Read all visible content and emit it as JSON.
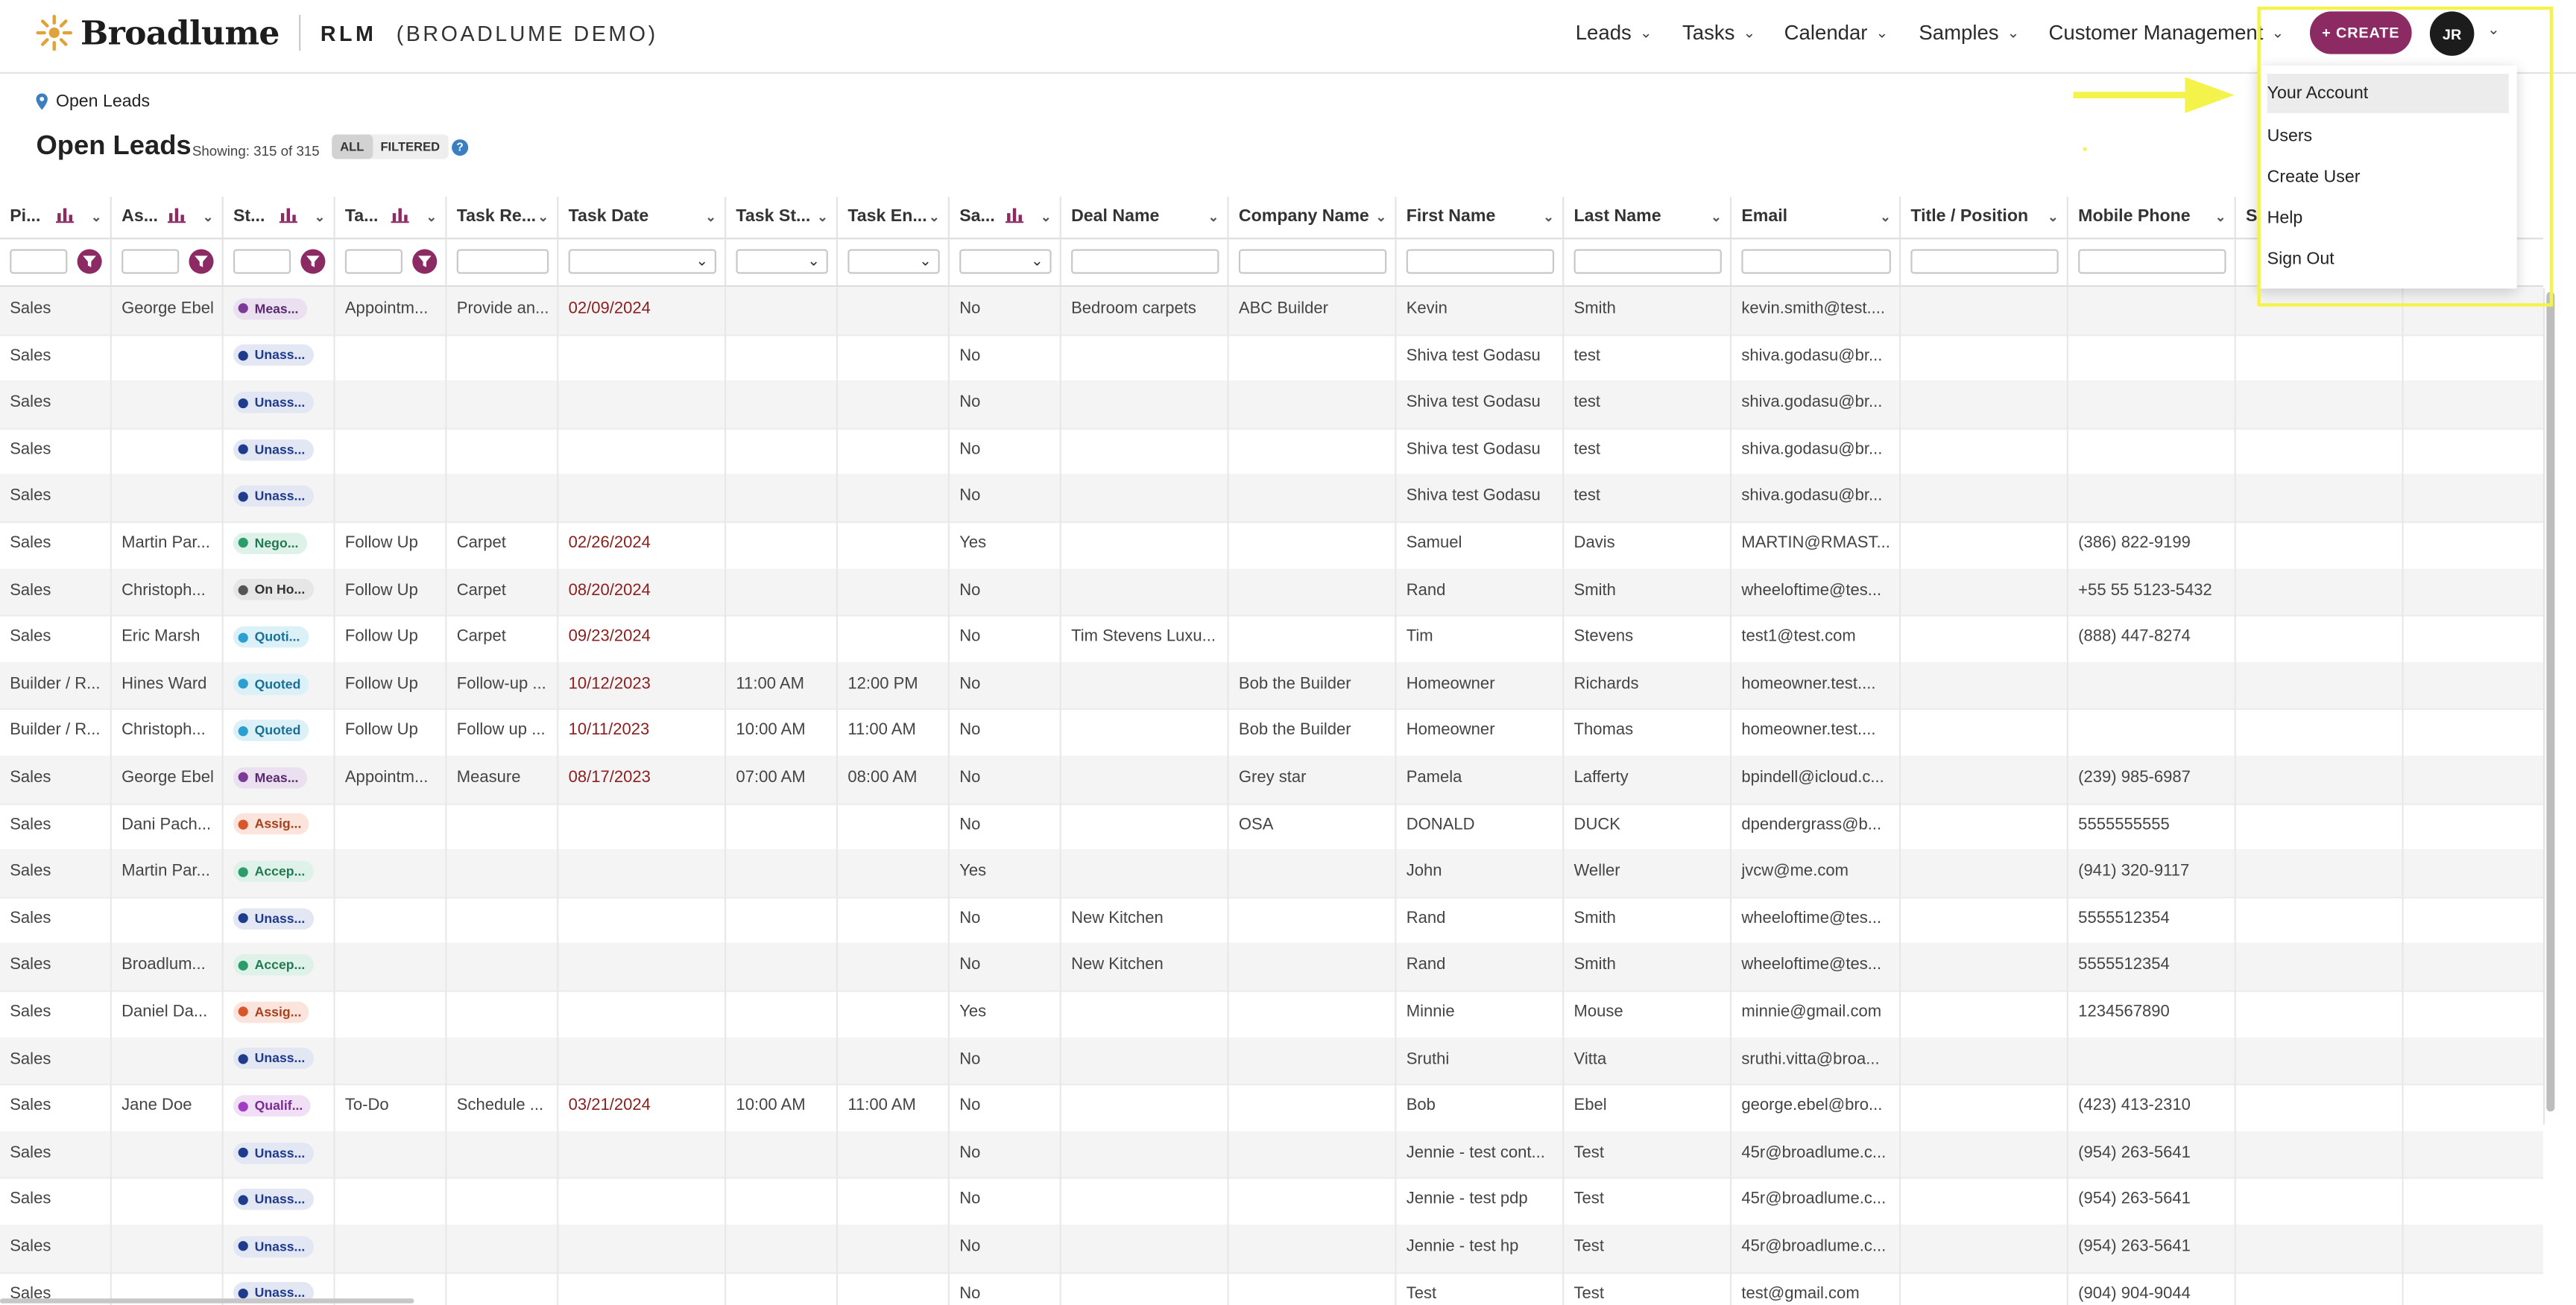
{
  "header": {
    "brand": "Broadlume",
    "app": "RLM",
    "demo": "(BROADLUME DEMO)",
    "nav": [
      {
        "label": "Leads"
      },
      {
        "label": "Tasks"
      },
      {
        "label": "Calendar"
      },
      {
        "label": "Samples"
      },
      {
        "label": "Customer Management"
      }
    ],
    "create_label": "+ CREATE",
    "avatar_initials": "JR",
    "accent_color": "#8c2b63"
  },
  "breadcrumb": {
    "label": "Open Leads",
    "icon": "location-pin-icon"
  },
  "page": {
    "title": "Open Leads",
    "showing": "Showing: 315 of 315",
    "toggle_all": "ALL",
    "toggle_filtered": "FILTERED",
    "help": "?"
  },
  "columns": [
    "Pi...",
    "As...",
    "St...",
    "Ta...",
    "Task Re...",
    "Task Date",
    "Task St...",
    "Task En...",
    "Sa...",
    "Deal Name",
    "Company Name",
    "First Name",
    "Last Name",
    "Email",
    "Title / Position",
    "Mobile Phone",
    "S"
  ],
  "rows": [
    {
      "pipeline": "Sales",
      "assignee": "George Ebel",
      "status": "Meas...",
      "status_kind": "measure",
      "task_type": "Appointm...",
      "task_re": "Provide an...",
      "task_date": "02/09/2024",
      "task_start": "",
      "task_end": "",
      "sample": "No",
      "deal": "Bedroom carpets",
      "company": "ABC Builder",
      "first": "Kevin",
      "last": "Smith",
      "email": "kevin.smith@test....",
      "title": "",
      "mobile": ""
    },
    {
      "pipeline": "Sales",
      "assignee": "",
      "status": "Unass...",
      "status_kind": "unassigned",
      "task_type": "",
      "task_re": "",
      "task_date": "",
      "task_start": "",
      "task_end": "",
      "sample": "No",
      "deal": "",
      "company": "",
      "first": "Shiva test Godasu",
      "last": "test",
      "email": "shiva.godasu@br...",
      "title": "",
      "mobile": ""
    },
    {
      "pipeline": "Sales",
      "assignee": "",
      "status": "Unass...",
      "status_kind": "unassigned",
      "task_type": "",
      "task_re": "",
      "task_date": "",
      "task_start": "",
      "task_end": "",
      "sample": "No",
      "deal": "",
      "company": "",
      "first": "Shiva test Godasu",
      "last": "test",
      "email": "shiva.godasu@br...",
      "title": "",
      "mobile": ""
    },
    {
      "pipeline": "Sales",
      "assignee": "",
      "status": "Unass...",
      "status_kind": "unassigned",
      "task_type": "",
      "task_re": "",
      "task_date": "",
      "task_start": "",
      "task_end": "",
      "sample": "No",
      "deal": "",
      "company": "",
      "first": "Shiva test Godasu",
      "last": "test",
      "email": "shiva.godasu@br...",
      "title": "",
      "mobile": ""
    },
    {
      "pipeline": "Sales",
      "assignee": "",
      "status": "Unass...",
      "status_kind": "unassigned",
      "task_type": "",
      "task_re": "",
      "task_date": "",
      "task_start": "",
      "task_end": "",
      "sample": "No",
      "deal": "",
      "company": "",
      "first": "Shiva test Godasu",
      "last": "test",
      "email": "shiva.godasu@br...",
      "title": "",
      "mobile": ""
    },
    {
      "pipeline": "Sales",
      "assignee": "Martin Par...",
      "status": "Nego...",
      "status_kind": "negotiation",
      "task_type": "Follow Up",
      "task_re": "Carpet",
      "task_date": "02/26/2024",
      "task_start": "",
      "task_end": "",
      "sample": "Yes",
      "deal": "",
      "company": "",
      "first": "Samuel",
      "last": "Davis",
      "email": "MARTIN@RMAST...",
      "title": "",
      "mobile": "(386) 822-9199"
    },
    {
      "pipeline": "Sales",
      "assignee": "Christoph...",
      "status": "On Ho...",
      "status_kind": "onhold",
      "task_type": "Follow Up",
      "task_re": "Carpet",
      "task_date": "08/20/2024",
      "task_start": "",
      "task_end": "",
      "sample": "No",
      "deal": "",
      "company": "",
      "first": "Rand",
      "last": "Smith",
      "email": "wheeloftime@tes...",
      "title": "",
      "mobile": "+55 55 5123-5432"
    },
    {
      "pipeline": "Sales",
      "assignee": "Eric Marsh",
      "status": "Quoti...",
      "status_kind": "quoted",
      "task_type": "Follow Up",
      "task_re": "Carpet",
      "task_date": "09/23/2024",
      "task_start": "",
      "task_end": "",
      "sample": "No",
      "deal": "Tim Stevens Luxu...",
      "company": "",
      "first": "Tim",
      "last": "Stevens",
      "email": "test1@test.com",
      "title": "",
      "mobile": "(888) 447-8274"
    },
    {
      "pipeline": "Builder / R...",
      "assignee": "Hines Ward",
      "status": "Quoted",
      "status_kind": "quoted",
      "task_type": "Follow Up",
      "task_re": "Follow-up ...",
      "task_date": "10/12/2023",
      "task_start": "11:00 AM",
      "task_end": "12:00 PM",
      "sample": "No",
      "deal": "",
      "company": "Bob the Builder",
      "first": "Homeowner",
      "last": "Richards",
      "email": "homeowner.test....",
      "title": "",
      "mobile": ""
    },
    {
      "pipeline": "Builder / R...",
      "assignee": "Christoph...",
      "status": "Quoted",
      "status_kind": "quoted",
      "task_type": "Follow Up",
      "task_re": "Follow up ...",
      "task_date": "10/11/2023",
      "task_start": "10:00 AM",
      "task_end": "11:00 AM",
      "sample": "No",
      "deal": "",
      "company": "Bob the Builder",
      "first": "Homeowner",
      "last": "Thomas",
      "email": "homeowner.test....",
      "title": "",
      "mobile": ""
    },
    {
      "pipeline": "Sales",
      "assignee": "George Ebel",
      "status": "Meas...",
      "status_kind": "measure",
      "task_type": "Appointm...",
      "task_re": "Measure",
      "task_date": "08/17/2023",
      "task_start": "07:00 AM",
      "task_end": "08:00 AM",
      "sample": "No",
      "deal": "",
      "company": "Grey star",
      "first": "Pamela",
      "last": "Lafferty",
      "email": "bpindell@icloud.c...",
      "title": "",
      "mobile": "(239) 985-6987"
    },
    {
      "pipeline": "Sales",
      "assignee": "Dani Pach...",
      "status": "Assig...",
      "status_kind": "assigned",
      "task_type": "",
      "task_re": "",
      "task_date": "",
      "task_start": "",
      "task_end": "",
      "sample": "No",
      "deal": "",
      "company": "OSA",
      "first": "DONALD",
      "last": "DUCK",
      "email": "dpendergrass@b...",
      "title": "",
      "mobile": "5555555555"
    },
    {
      "pipeline": "Sales",
      "assignee": "Martin Par...",
      "status": "Accep...",
      "status_kind": "accepted",
      "task_type": "",
      "task_re": "",
      "task_date": "",
      "task_start": "",
      "task_end": "",
      "sample": "Yes",
      "deal": "",
      "company": "",
      "first": "John",
      "last": "Weller",
      "email": "jvcw@me.com",
      "title": "",
      "mobile": "(941) 320-9117"
    },
    {
      "pipeline": "Sales",
      "assignee": "",
      "status": "Unass...",
      "status_kind": "unassigned",
      "task_type": "",
      "task_re": "",
      "task_date": "",
      "task_start": "",
      "task_end": "",
      "sample": "No",
      "deal": "New Kitchen",
      "company": "",
      "first": "Rand",
      "last": "Smith",
      "email": "wheeloftime@tes...",
      "title": "",
      "mobile": "5555512354"
    },
    {
      "pipeline": "Sales",
      "assignee": "Broadlum...",
      "status": "Accep...",
      "status_kind": "accepted",
      "task_type": "",
      "task_re": "",
      "task_date": "",
      "task_start": "",
      "task_end": "",
      "sample": "No",
      "deal": "New Kitchen",
      "company": "",
      "first": "Rand",
      "last": "Smith",
      "email": "wheeloftime@tes...",
      "title": "",
      "mobile": "5555512354"
    },
    {
      "pipeline": "Sales",
      "assignee": "Daniel Da...",
      "status": "Assig...",
      "status_kind": "assigned",
      "task_type": "",
      "task_re": "",
      "task_date": "",
      "task_start": "",
      "task_end": "",
      "sample": "Yes",
      "deal": "",
      "company": "",
      "first": "Minnie",
      "last": "Mouse",
      "email": "minnie@gmail.com",
      "title": "",
      "mobile": "1234567890"
    },
    {
      "pipeline": "Sales",
      "assignee": "",
      "status": "Unass...",
      "status_kind": "unassigned",
      "task_type": "",
      "task_re": "",
      "task_date": "",
      "task_start": "",
      "task_end": "",
      "sample": "No",
      "deal": "",
      "company": "",
      "first": "Sruthi",
      "last": "Vitta",
      "email": "sruthi.vitta@broa...",
      "title": "",
      "mobile": ""
    },
    {
      "pipeline": "Sales",
      "assignee": "Jane Doe",
      "status": "Qualif...",
      "status_kind": "qualified",
      "task_type": "To-Do",
      "task_re": "Schedule ...",
      "task_date": "03/21/2024",
      "task_start": "10:00 AM",
      "task_end": "11:00 AM",
      "sample": "No",
      "deal": "",
      "company": "",
      "first": "Bob",
      "last": "Ebel",
      "email": "george.ebel@bro...",
      "title": "",
      "mobile": "(423) 413-2310"
    },
    {
      "pipeline": "Sales",
      "assignee": "",
      "status": "Unass...",
      "status_kind": "unassigned",
      "task_type": "",
      "task_re": "",
      "task_date": "",
      "task_start": "",
      "task_end": "",
      "sample": "No",
      "deal": "",
      "company": "",
      "first": "Jennie - test cont...",
      "last": "Test",
      "email": "45r@broadlume.c...",
      "title": "",
      "mobile": "(954) 263-5641"
    },
    {
      "pipeline": "Sales",
      "assignee": "",
      "status": "Unass...",
      "status_kind": "unassigned",
      "task_type": "",
      "task_re": "",
      "task_date": "",
      "task_start": "",
      "task_end": "",
      "sample": "No",
      "deal": "",
      "company": "",
      "first": "Jennie - test pdp",
      "last": "Test",
      "email": "45r@broadlume.c...",
      "title": "",
      "mobile": "(954) 263-5641"
    },
    {
      "pipeline": "Sales",
      "assignee": "",
      "status": "Unass...",
      "status_kind": "unassigned",
      "task_type": "",
      "task_re": "",
      "task_date": "",
      "task_start": "",
      "task_end": "",
      "sample": "No",
      "deal": "",
      "company": "",
      "first": "Jennie - test hp",
      "last": "Test",
      "email": "45r@broadlume.c...",
      "title": "",
      "mobile": "(954) 263-5641"
    },
    {
      "pipeline": "Sales",
      "assignee": "",
      "status": "Unass...",
      "status_kind": "unassigned",
      "task_type": "",
      "task_re": "",
      "task_date": "",
      "task_start": "",
      "task_end": "",
      "sample": "No",
      "deal": "",
      "company": "",
      "first": "Test",
      "last": "Test",
      "email": "test@gmail.com",
      "title": "",
      "mobile": "(904) 904-9044"
    }
  ],
  "status_colors": {
    "measure": {
      "bg": "#ebe0f0",
      "dot": "#7b3a96",
      "text": "#5a2a70"
    },
    "unassigned": {
      "bg": "#e3e7f4",
      "dot": "#1f3b8c",
      "text": "#1f3b8c"
    },
    "negotiation": {
      "bg": "#dff2ea",
      "dot": "#2e9c6a",
      "text": "#1f7a50"
    },
    "onhold": {
      "bg": "#e6e6e6",
      "dot": "#555555",
      "text": "#333333"
    },
    "quoted": {
      "bg": "#dcf0f8",
      "dot": "#2a9fd0",
      "text": "#1a6f96"
    },
    "assigned": {
      "bg": "#fbe4dc",
      "dot": "#d9562b",
      "text": "#a8401e"
    },
    "accepted": {
      "bg": "#dff2ea",
      "dot": "#2e9c6a",
      "text": "#1f7a50"
    },
    "qualified": {
      "bg": "#f1e0f5",
      "dot": "#a23cc4",
      "text": "#7a2a96"
    }
  },
  "account_menu": {
    "items": [
      {
        "label": "Your Account",
        "highlighted": true
      },
      {
        "label": "Users"
      },
      {
        "label": "Create User"
      },
      {
        "label": "Help"
      },
      {
        "label": "Sign Out"
      }
    ]
  }
}
